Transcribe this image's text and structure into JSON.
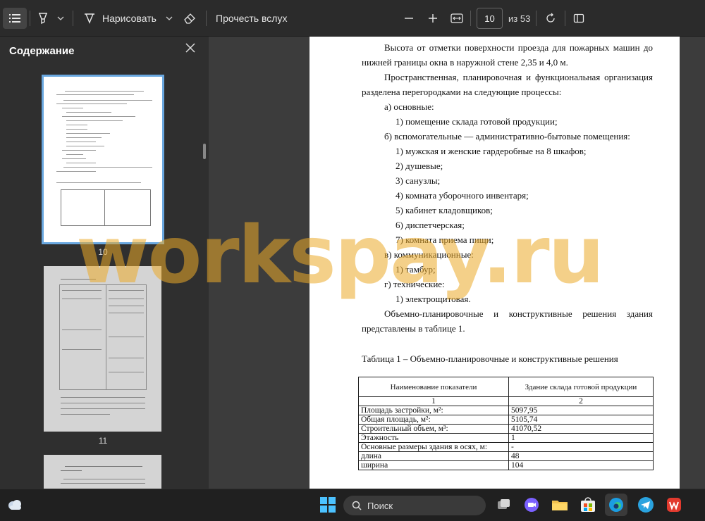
{
  "toolbar": {
    "draw_label": "Нарисовать",
    "read_aloud_label": "Прочесть вслух",
    "current_page": "10",
    "total_pages": "из 53"
  },
  "sidebar": {
    "title": "Содержание",
    "thumbnails": [
      {
        "page": "10"
      },
      {
        "page": "11"
      }
    ]
  },
  "document": {
    "lines": [
      "Высота от отметки поверхности проезда для пожарных машин до",
      "нижней границы окна в наружной стене 2,35 и 4,0 м.",
      "Пространственная, планировочная и функциональная организация",
      "разделена перегородками на следующие процессы:",
      "а) основные:",
      "1)  помещение склада готовой продукции;",
      "б) вспомогательные — административно-бытовые помещения:",
      "1)  мужская и женские гардеробные на 8 шкафов;",
      "2)  душевые;",
      "3)  санузлы;",
      "4)  комната уборочного инвентаря;",
      "5)  кабинет кладовщиков;",
      "6)  диспетчерская;",
      "7)  комната приема пищи;",
      "в) коммуникационные:",
      "1)  тамбур;",
      "г) технические:",
      "1)  электрощитовая.",
      "Объемно-планировочные и конструктивные решения здания",
      "представлены в таблице 1."
    ],
    "table_caption": "Таблица 1 – Объемно-планировочные и конструктивные решения",
    "table": {
      "headers": [
        "Наименование показатели",
        "Здание склада готовой продукции"
      ],
      "col_numbers": [
        "1",
        "2"
      ],
      "rows": [
        [
          "Площадь застройки, м²:",
          "5097,95"
        ],
        [
          "Общая площадь, м²:",
          "5105,74"
        ],
        [
          "Строительный объем, м³:",
          "41070,52"
        ],
        [
          "Этажность",
          "1"
        ],
        [
          "Основные размеры здания в осях, м:",
          "-"
        ],
        [
          "длина",
          "48"
        ],
        [
          "ширина",
          "104"
        ]
      ]
    }
  },
  "watermark": "workspay.ru",
  "taskbar": {
    "search_placeholder": "Поиск"
  },
  "colors": {
    "toolbar_bg": "#2b2b2b",
    "sidebar_bg": "#2f2f2f",
    "viewer_bg": "#3c3c3c",
    "accent": "#4a9ee8",
    "watermark": "#ebaa28"
  }
}
